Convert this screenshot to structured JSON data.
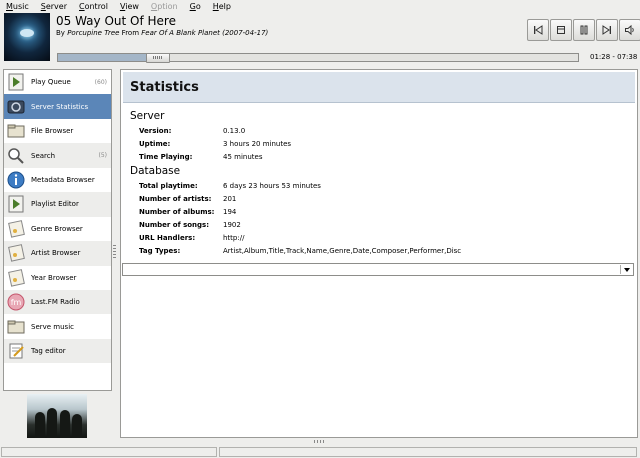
{
  "menubar": {
    "items": [
      {
        "label": "Music",
        "enabled": true
      },
      {
        "label": "Server",
        "enabled": true
      },
      {
        "label": "Control",
        "enabled": true
      },
      {
        "label": "View",
        "enabled": true
      },
      {
        "label": "Option",
        "enabled": false
      },
      {
        "label": "Go",
        "enabled": true
      },
      {
        "label": "Help",
        "enabled": true
      }
    ]
  },
  "now_playing": {
    "title": "05 Way Out Of Here",
    "by_label": "By",
    "artist": "Porcupine Tree",
    "from_label": "From",
    "album": "Fear Of A Blank Planet (2007-04-17)",
    "time": "01:28 - 07:38",
    "progress_fraction": 0.19
  },
  "controls": [
    {
      "name": "previous-icon"
    },
    {
      "name": "stop-icon"
    },
    {
      "name": "pause-icon"
    },
    {
      "name": "next-icon"
    },
    {
      "name": "volume-icon"
    }
  ],
  "sidebar": {
    "items": [
      {
        "label": "Play Queue",
        "count": "(60)",
        "icon": "play-queue-icon",
        "selected": false
      },
      {
        "label": "Server Statistics",
        "count": "",
        "icon": "server-statistics-icon",
        "selected": true
      },
      {
        "label": "File Browser",
        "count": "",
        "icon": "folder-icon",
        "selected": false
      },
      {
        "label": "Search",
        "count": "(5)",
        "icon": "search-icon",
        "selected": false
      },
      {
        "label": "Metadata Browser",
        "count": "",
        "icon": "info-icon",
        "selected": false
      },
      {
        "label": "Playlist Editor",
        "count": "",
        "icon": "playlist-icon",
        "selected": false
      },
      {
        "label": "Genre Browser",
        "count": "",
        "icon": "genre-icon",
        "selected": false
      },
      {
        "label": "Artist Browser",
        "count": "",
        "icon": "artist-icon",
        "selected": false
      },
      {
        "label": "Year Browser",
        "count": "",
        "icon": "year-icon",
        "selected": false
      },
      {
        "label": "Last.FM Radio",
        "count": "",
        "icon": "lastfm-icon",
        "selected": false
      },
      {
        "label": "Serve music",
        "count": "",
        "icon": "serve-music-icon",
        "selected": false
      },
      {
        "label": "Tag editor",
        "count": "",
        "icon": "tag-editor-icon",
        "selected": false
      }
    ]
  },
  "main": {
    "title": "Statistics",
    "server": {
      "heading": "Server",
      "rows": [
        {
          "key": "Version:",
          "value": "0.13.0"
        },
        {
          "key": "Uptime:",
          "value": "3 hours 20 minutes"
        },
        {
          "key": "Time Playing:",
          "value": "45 minutes"
        }
      ]
    },
    "database": {
      "heading": "Database",
      "rows": [
        {
          "key": "Total playtime:",
          "value": "6 days 23 hours 53 minutes"
        },
        {
          "key": "Number of artists:",
          "value": "201"
        },
        {
          "key": "Number of albums:",
          "value": "194"
        },
        {
          "key": "Number of songs:",
          "value": "1902"
        },
        {
          "key": "URL Handlers:",
          "value": "http://"
        },
        {
          "key": "Tag Types:",
          "value": "Artist,Album,Title,Track,Name,Genre,Date,Composer,Performer,Disc"
        }
      ]
    },
    "dropdown_value": ""
  },
  "colors": {
    "selection": "#5b86b8",
    "header_bg": "#dbe3ec",
    "progress_fill": "#a4b6c8"
  }
}
